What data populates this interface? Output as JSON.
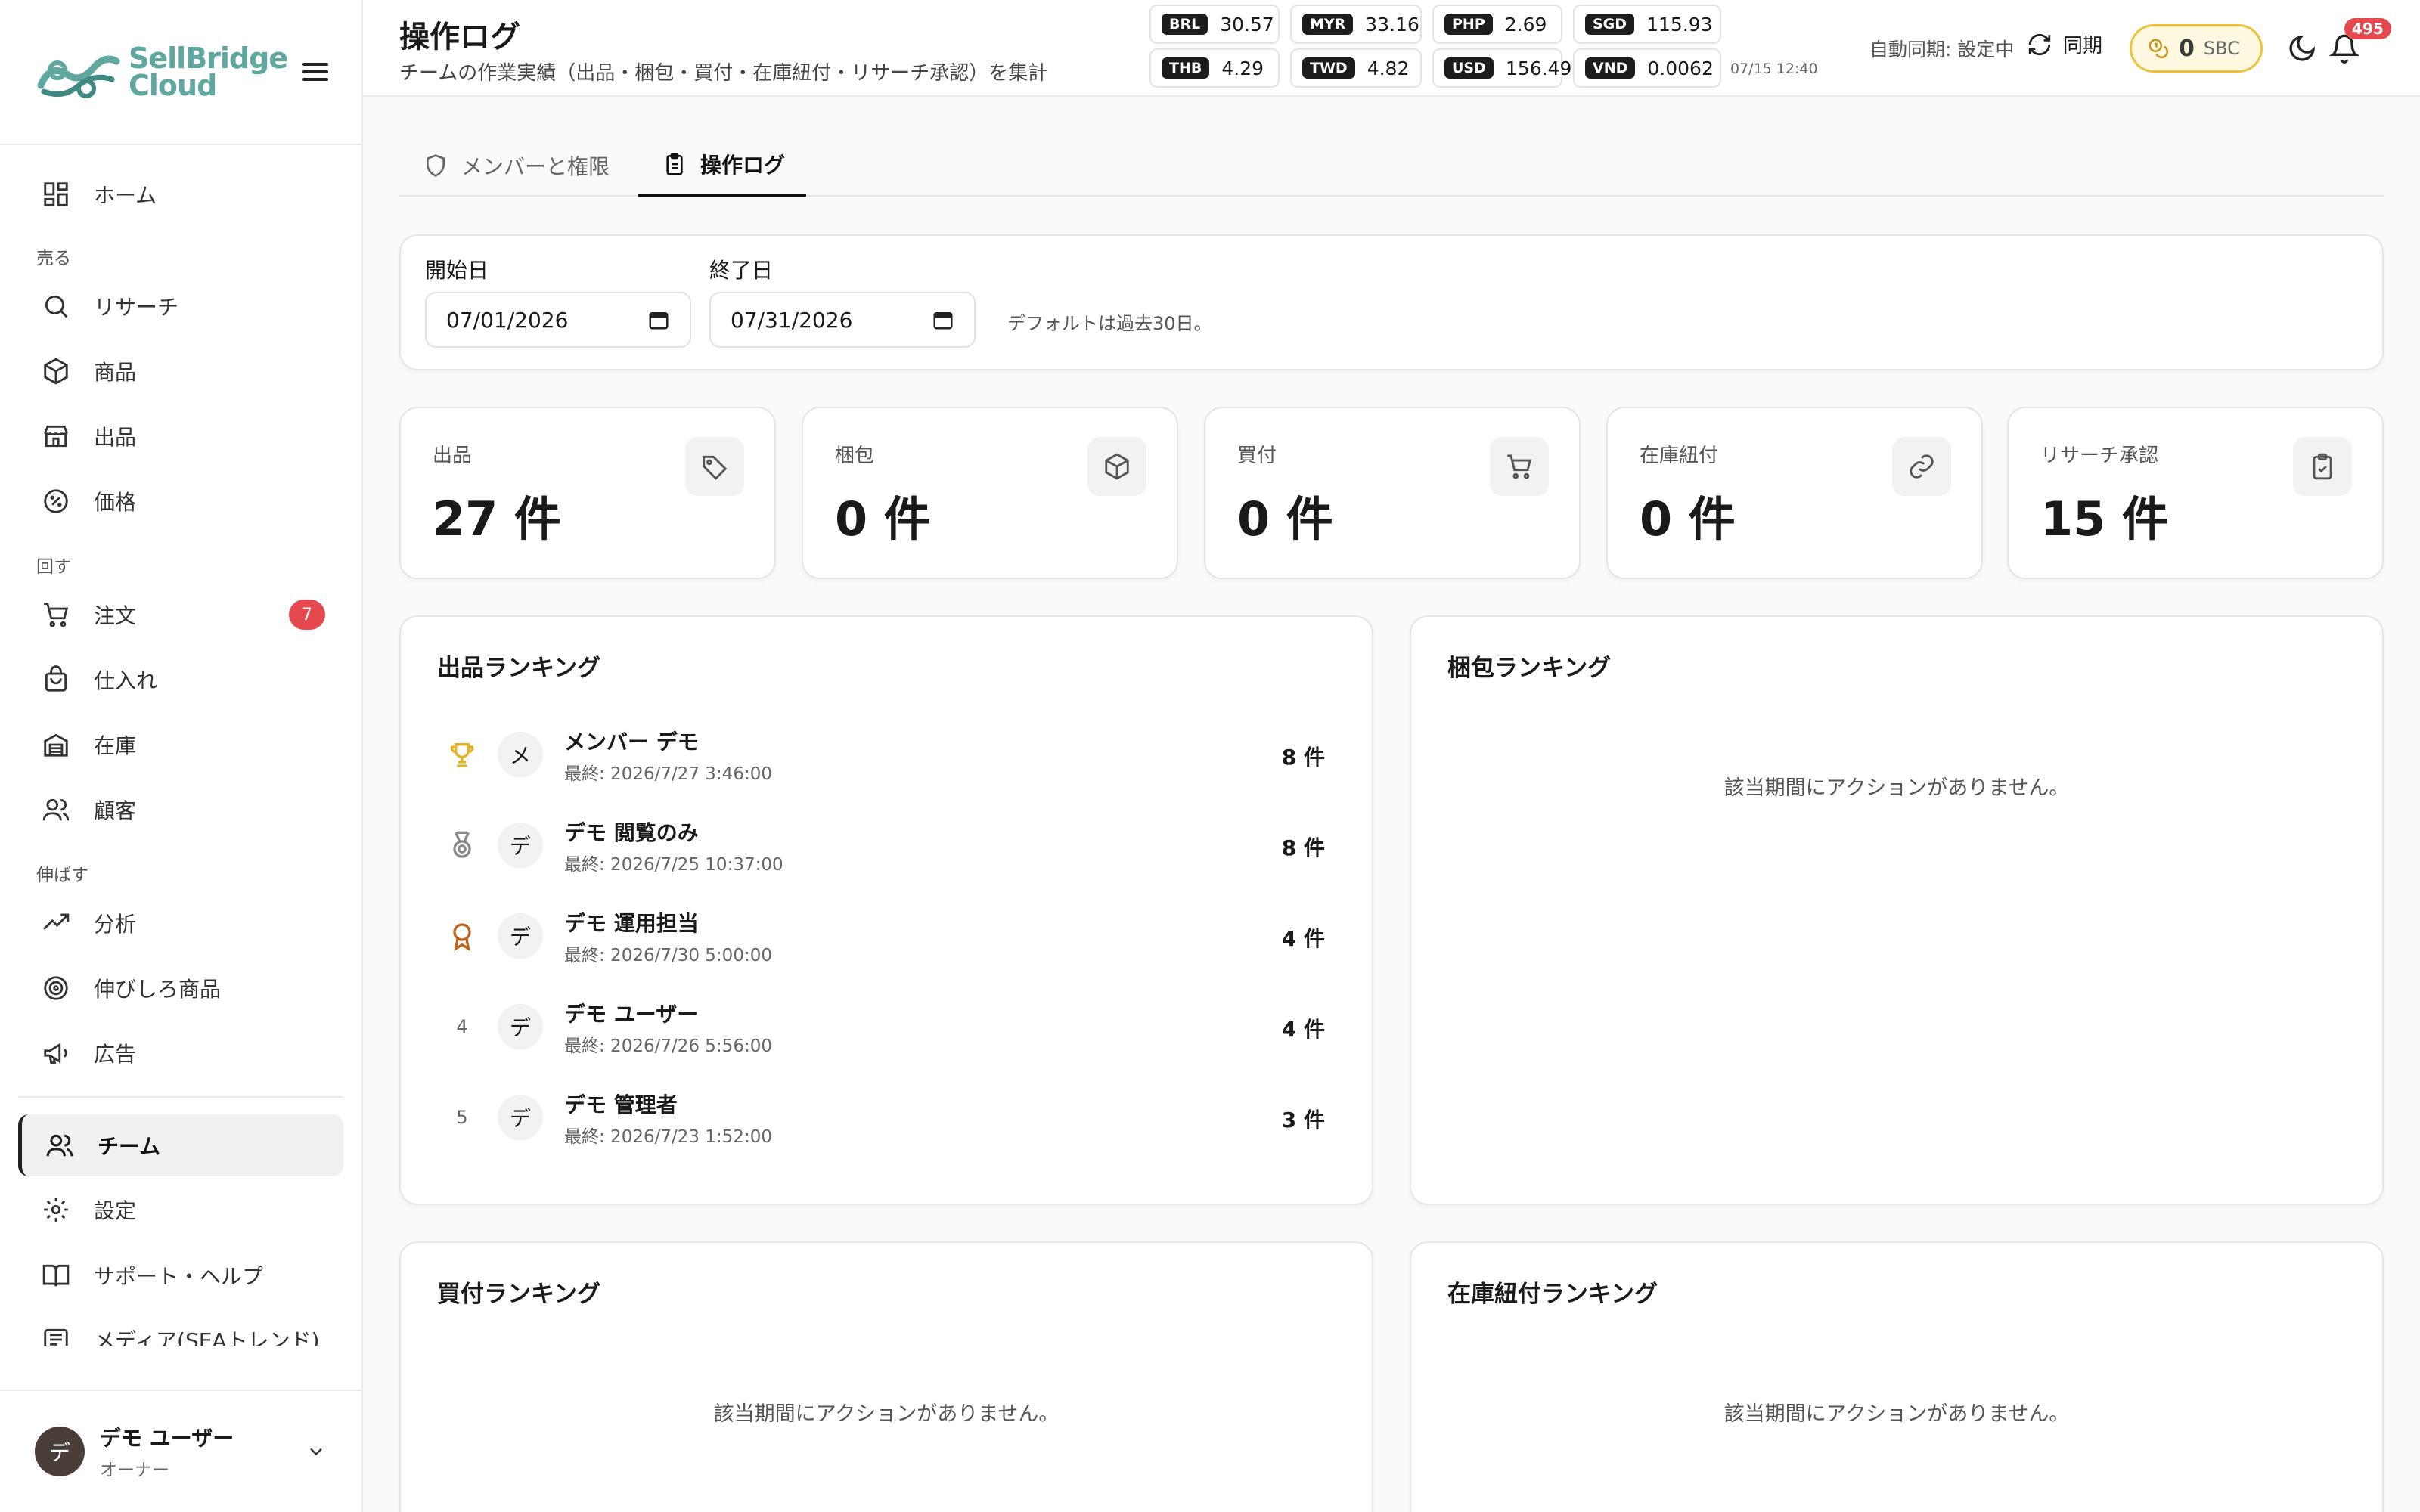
{
  "brand": {
    "name_line1": "SellBridge",
    "name_line2": "Cloud"
  },
  "sidebar": {
    "home": "ホーム",
    "sections": {
      "sell": "売る",
      "run": "回す",
      "grow": "伸ばす"
    },
    "items": {
      "research": "リサーチ",
      "products": "商品",
      "listings": "出品",
      "pricing": "価格",
      "orders": "注文",
      "orders_badge": "7",
      "purchasing": "仕入れ",
      "inventory": "在庫",
      "customers": "顧客",
      "analytics": "分析",
      "growth_products": "伸びしろ商品",
      "ads": "広告",
      "team": "チーム",
      "settings": "設定",
      "support": "サポート・ヘルプ",
      "media": "メディア(SEAトレンド)"
    },
    "user": {
      "avatar_initial": "デ",
      "name": "デモ ユーザー",
      "role": "オーナー"
    }
  },
  "header": {
    "title": "操作ログ",
    "subtitle": "チームの作業実績（出品・梱包・買付・在庫紐付・リサーチ承認）を集計",
    "fx_rates": [
      {
        "code": "BRL",
        "value": "30.57"
      },
      {
        "code": "MYR",
        "value": "33.16"
      },
      {
        "code": "PHP",
        "value": "2.69"
      },
      {
        "code": "SGD",
        "value": "115.93"
      },
      {
        "code": "THB",
        "value": "4.29"
      },
      {
        "code": "TWD",
        "value": "4.82"
      },
      {
        "code": "USD",
        "value": "156.49"
      },
      {
        "code": "VND",
        "value": "0.0062"
      }
    ],
    "fx_time": "07/15 12:40",
    "auto_sync": "自動同期: 設定中",
    "sync_button": "同期",
    "coin_amount": "0",
    "coin_unit": "SBC",
    "notification_count": "495"
  },
  "tabs": {
    "members": "メンバーと権限",
    "activity_log": "操作ログ"
  },
  "filter": {
    "start_label": "開始日",
    "start_value": "07/01/2026",
    "end_label": "終了日",
    "end_value": "07/31/2026",
    "hint": "デフォルトは過去30日。"
  },
  "stats": {
    "listing": {
      "label": "出品",
      "value": "27 件"
    },
    "packing": {
      "label": "梱包",
      "value": "0 件"
    },
    "buying": {
      "label": "買付",
      "value": "0 件"
    },
    "linking": {
      "label": "在庫紐付",
      "value": "0 件"
    },
    "research": {
      "label": "リサーチ承認",
      "value": "15 件"
    }
  },
  "rankings": {
    "listing_title": "出品ランキング",
    "packing_title": "梱包ランキング",
    "buying_title": "買付ランキング",
    "linking_title": "在庫紐付ランキング",
    "empty_text": "該当期間にアクションがありません。",
    "listing_rows": [
      {
        "rank": "1",
        "initial": "メ",
        "name": "メンバー デモ",
        "last": "最終: 2026/7/27 3:46:00",
        "count": "8 件"
      },
      {
        "rank": "2",
        "initial": "デ",
        "name": "デモ 閲覧のみ",
        "last": "最終: 2026/7/25 10:37:00",
        "count": "8 件"
      },
      {
        "rank": "3",
        "initial": "デ",
        "name": "デモ 運用担当",
        "last": "最終: 2026/7/30 5:00:00",
        "count": "4 件"
      },
      {
        "rank": "4",
        "initial": "デ",
        "name": "デモ ユーザー",
        "last": "最終: 2026/7/26 5:56:00",
        "count": "4 件"
      },
      {
        "rank": "5",
        "initial": "デ",
        "name": "デモ 管理者",
        "last": "最終: 2026/7/23 1:52:00",
        "count": "3 件"
      }
    ]
  },
  "colors": {
    "accent_gold": "#e6b422",
    "silver": "#8a8a8a",
    "bronze": "#c2621a",
    "badge_red": "#e5484d",
    "brand_teal": "#5fa8a0"
  }
}
